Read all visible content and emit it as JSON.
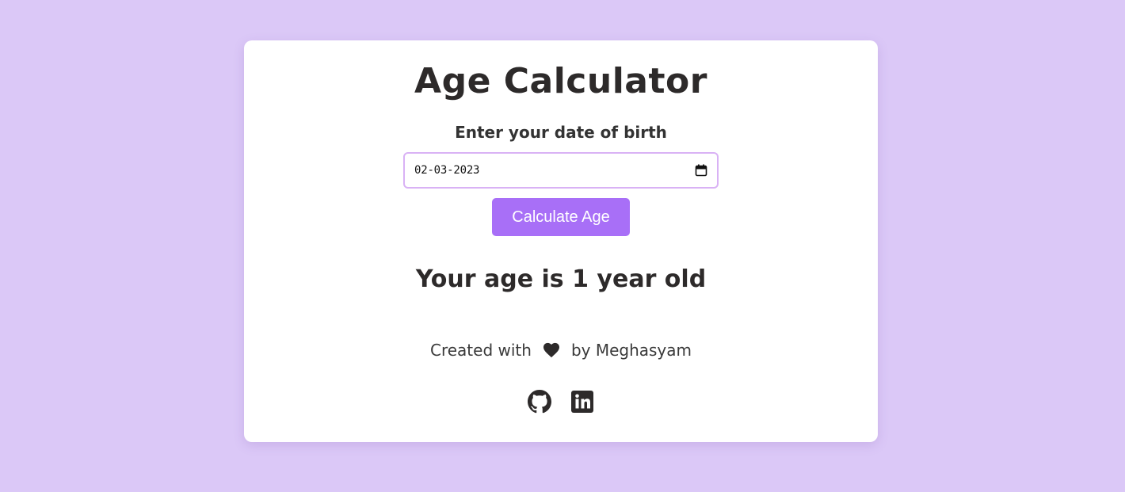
{
  "app": {
    "title": "Age Calculator"
  },
  "form": {
    "dob_label": "Enter your date of birth",
    "date_value": "02-03-2023",
    "calculate_button_label": "Calculate Age"
  },
  "result": {
    "text": "Your age is 1 year old"
  },
  "footer": {
    "credit_prefix": "Created with",
    "credit_suffix": "by Meghasyam",
    "icons": [
      "heart-icon",
      "github-icon",
      "linkedin-icon"
    ]
  },
  "colors": {
    "background": "#dbc8f7",
    "card": "#ffffff",
    "accent": "#a86ff7",
    "input_border": "#d9b2f5",
    "text": "#2d2a2a"
  }
}
